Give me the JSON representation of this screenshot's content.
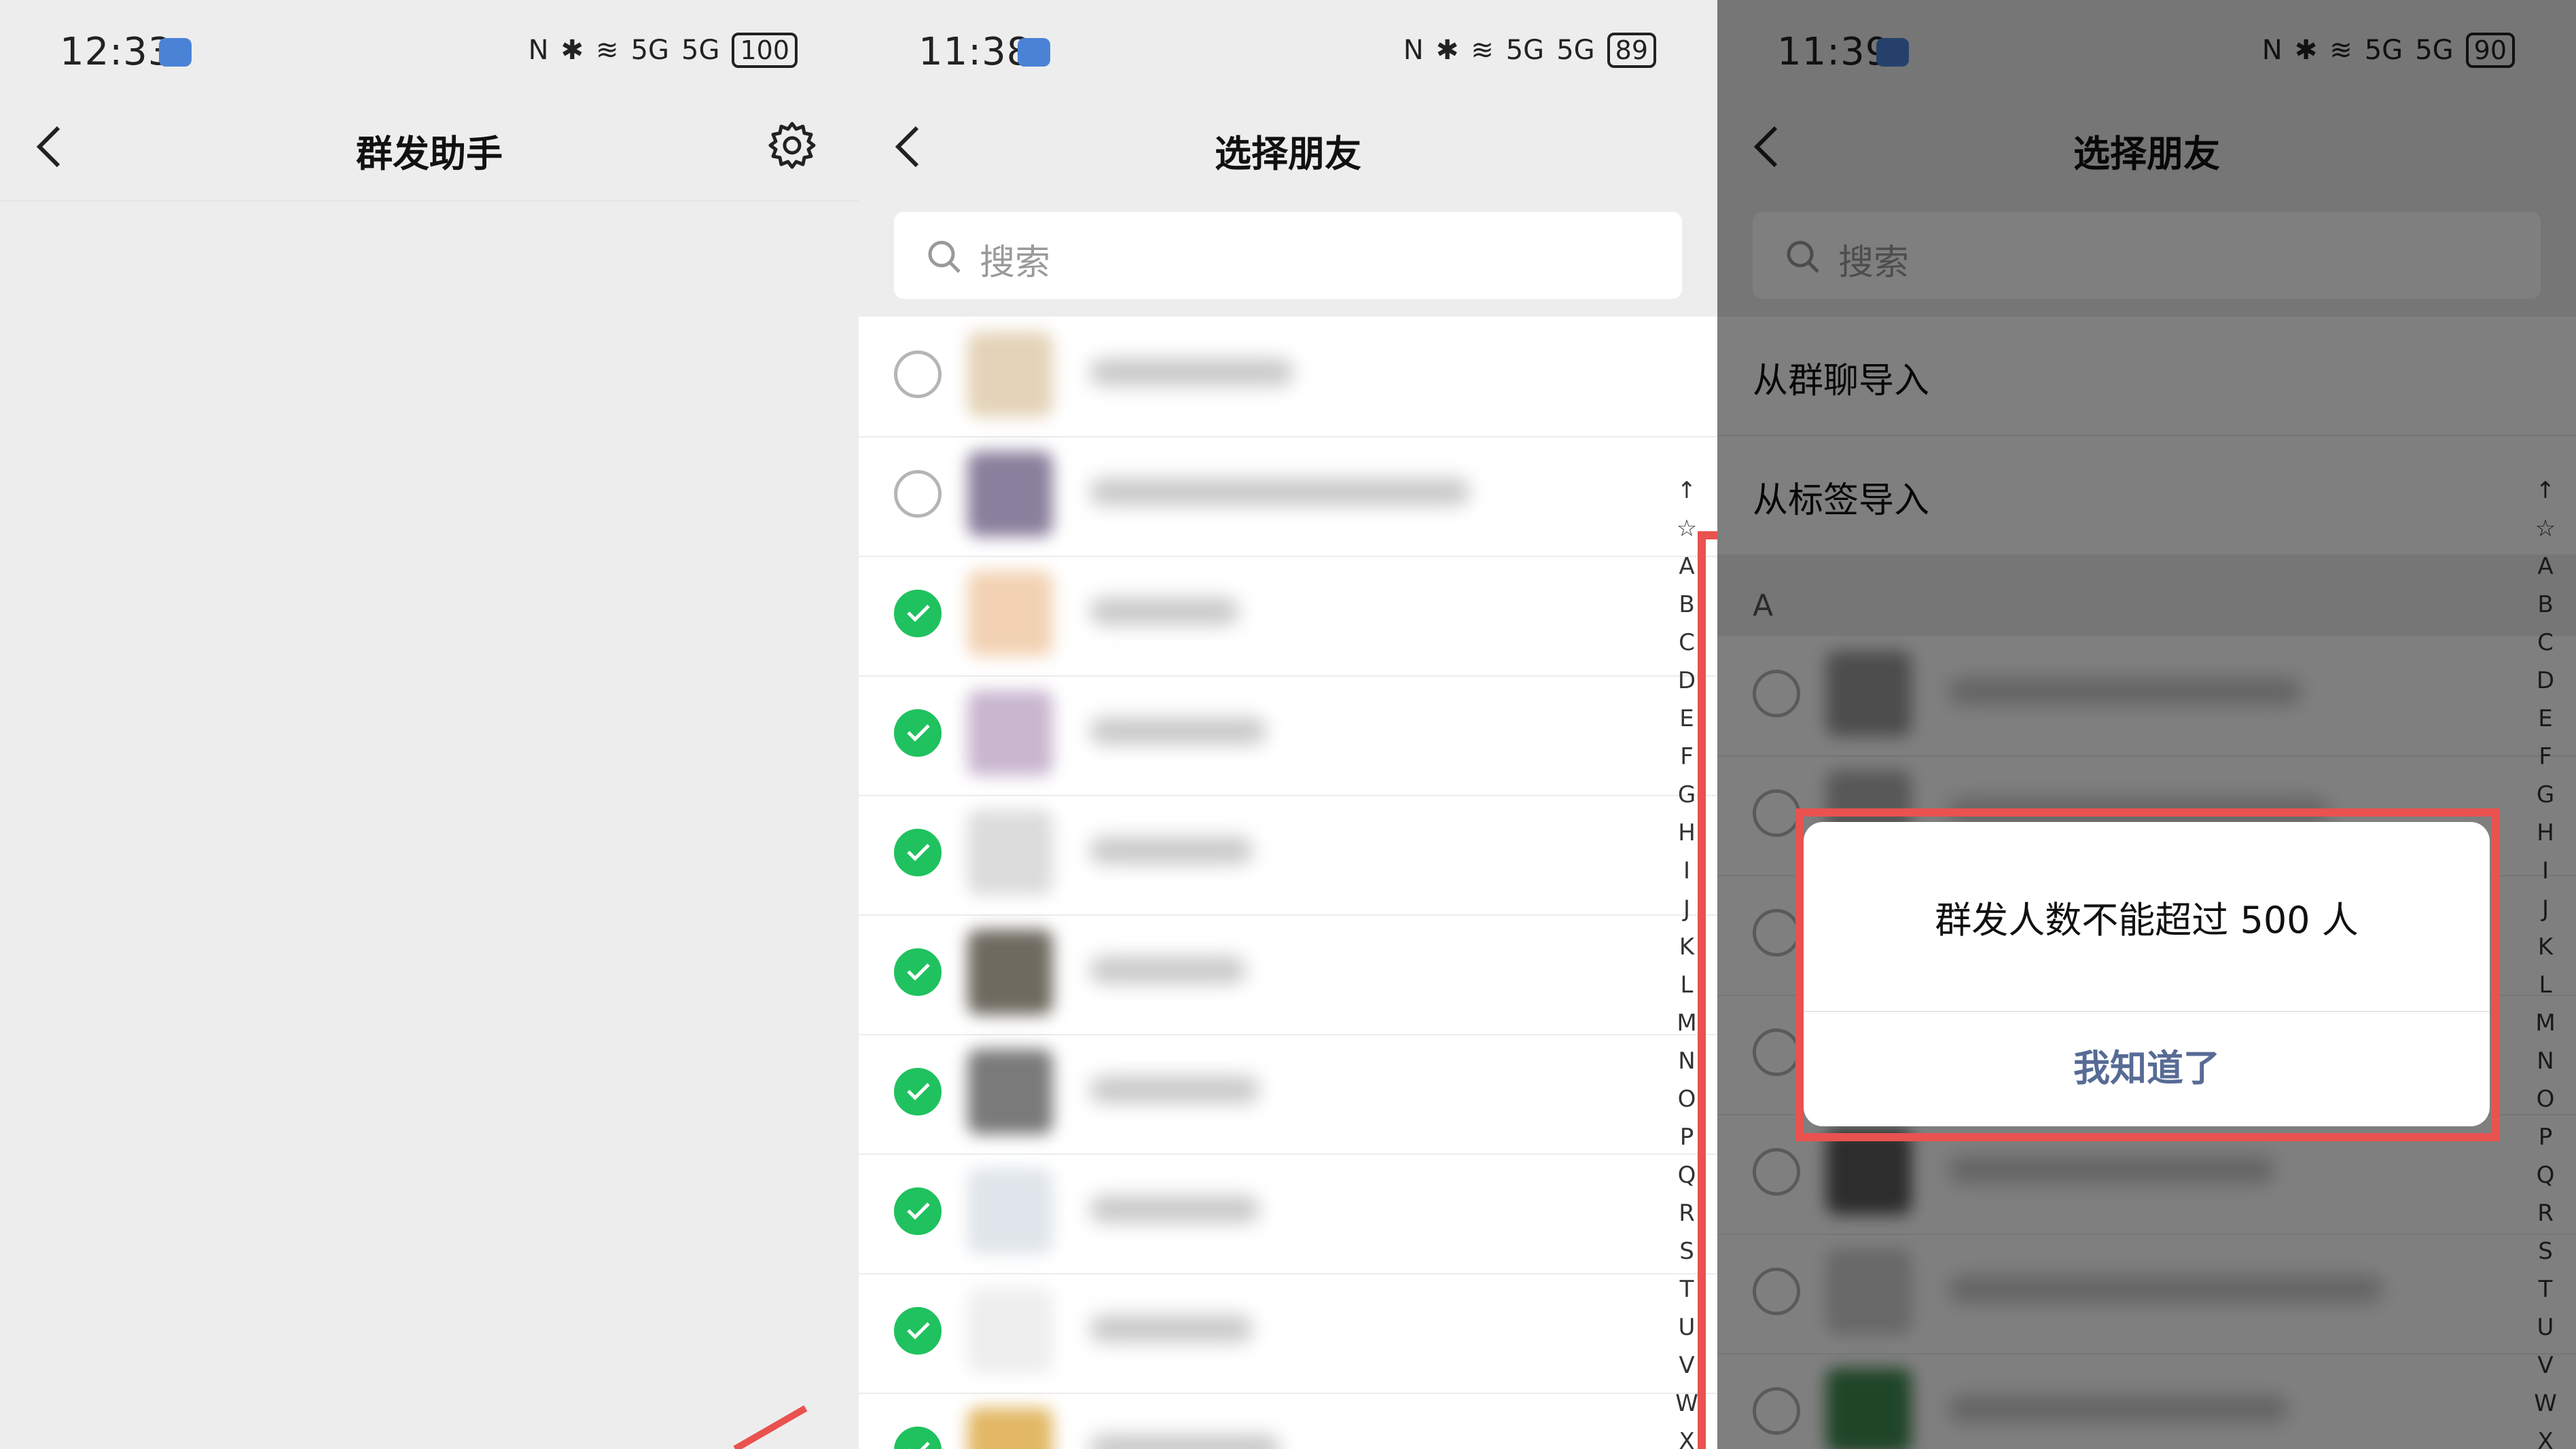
{
  "panel1": {
    "status": {
      "time": "12:33",
      "battery": "100"
    },
    "nav": {
      "title": "群发助手"
    }
  },
  "panel2": {
    "status": {
      "time": "11:38",
      "battery": "89"
    },
    "nav": {
      "title": "选择朋友"
    },
    "search": {
      "placeholder": "搜索"
    },
    "rows_checked": [
      false,
      false,
      true,
      true,
      true,
      true,
      true,
      true,
      true,
      true
    ],
    "index": [
      "↑",
      "☆",
      "A",
      "B",
      "C",
      "D",
      "E",
      "F",
      "G",
      "H",
      "I",
      "J",
      "K",
      "L",
      "M",
      "N",
      "O",
      "P",
      "Q",
      "R",
      "S",
      "T",
      "U",
      "V",
      "W",
      "X"
    ]
  },
  "panel3": {
    "status": {
      "time": "11:39",
      "battery": "90"
    },
    "nav": {
      "title": "选择朋友"
    },
    "search": {
      "placeholder": "搜索"
    },
    "sections": {
      "from_group": "从群聊导入",
      "from_tag": "从标签导入"
    },
    "group_letter": "A",
    "index": [
      "↑",
      "☆",
      "A",
      "B",
      "C",
      "D",
      "E",
      "F",
      "G",
      "H",
      "I",
      "J",
      "K",
      "L",
      "M",
      "N",
      "O",
      "P",
      "Q",
      "R",
      "S",
      "T",
      "U",
      "V",
      "W",
      "X"
    ],
    "dialog": {
      "message": "群发人数不能超过 500 人",
      "confirm": "我知道了"
    }
  },
  "status_icons": {
    "nfc": "N",
    "bluetooth": "✱",
    "wifi": "wifi-icon",
    "sig1": "5G",
    "sig2": "5G"
  },
  "colors": {
    "check_green": "#1fc25e",
    "highlight_red": "#e9524f",
    "dialog_button": "#576b95"
  }
}
